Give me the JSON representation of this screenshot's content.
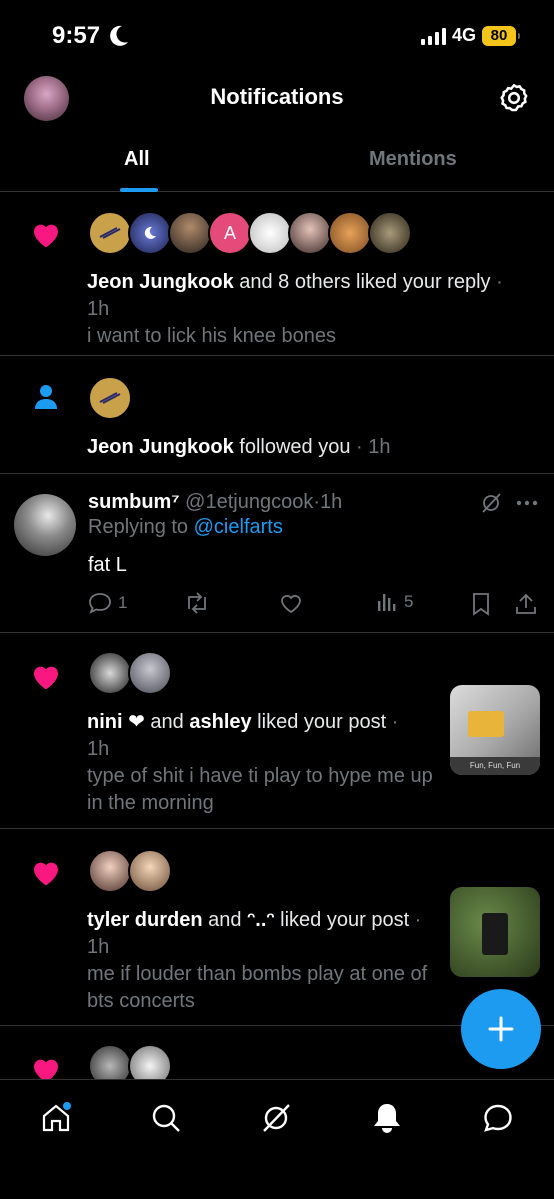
{
  "status_bar": {
    "time": "9:57",
    "network": "4G",
    "battery": "80"
  },
  "header": {
    "title": "Notifications"
  },
  "tabs": [
    {
      "label": "All",
      "active": true
    },
    {
      "label": "Mentions",
      "active": false
    }
  ],
  "notifications": [
    {
      "type": "like",
      "actor": "Jeon Jungkook",
      "action": " and 8 others liked your reply",
      "time": "1h",
      "snippet": "i want to lick his knee bones",
      "avatar_initial": "A"
    },
    {
      "type": "follow",
      "actor": "Jeon Jungkook",
      "action": " followed you",
      "time": "1h"
    },
    {
      "type": "reply",
      "name": "sumbum⁷",
      "handle": "@1etjungcook",
      "time": "1h",
      "replying_prefix": "Replying to ",
      "replying_to": "@cielfarts",
      "body": "fat L",
      "stats": {
        "replies": "1",
        "views": "5"
      }
    },
    {
      "type": "like",
      "actor": "nini ❤",
      "joiner": " and ",
      "actor2": "ashley",
      "action": " liked your post",
      "time": "1h",
      "snippet": "type of shit i have ti play to hype me up in the morning",
      "thumb_caption": "Fun, Fun, Fun"
    },
    {
      "type": "like",
      "actor": "tyler durden",
      "joiner": " and ",
      "actor2": "ᵔ..ᵔ",
      "action": " liked your post",
      "time": "1h",
      "snippet": "me if louder than bombs play at one of bts concerts"
    }
  ],
  "colors": {
    "accent": "#1d9bf0",
    "like": "#f91880",
    "muted": "#71767b",
    "divider": "#2f3336"
  },
  "icons": {
    "nav": [
      "home-icon",
      "search-icon",
      "grok-icon",
      "notifications-icon",
      "messages-icon"
    ],
    "fab": "plus-icon"
  }
}
